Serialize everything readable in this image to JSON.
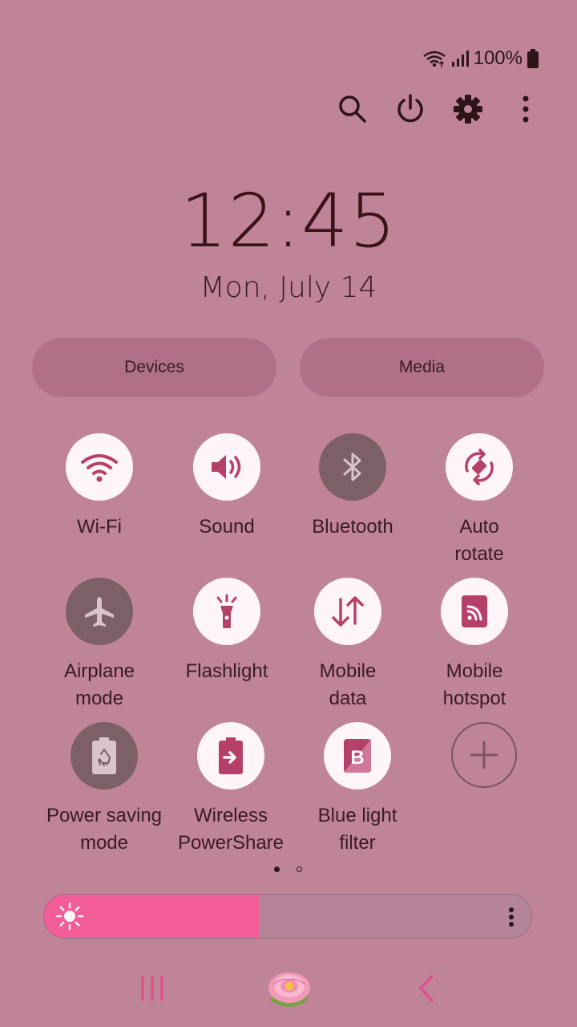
{
  "status_bar": {
    "battery_text": "100%",
    "icons": [
      "wifi-icon",
      "signal-icon",
      "battery-icon"
    ]
  },
  "actions": [
    "search-icon",
    "power-icon",
    "settings-icon",
    "more-icon"
  ],
  "clock": {
    "time": "12:45",
    "date": "Mon, July 14"
  },
  "pills": {
    "devices": "Devices",
    "media": "Media"
  },
  "tiles": [
    {
      "label": "Wi-Fi",
      "icon": "wifi-icon",
      "state": "on"
    },
    {
      "label": "Sound",
      "icon": "sound-icon",
      "state": "on"
    },
    {
      "label": "Bluetooth",
      "icon": "bluetooth-icon",
      "state": "off"
    },
    {
      "label": "Auto\nrotate",
      "icon": "auto-rotate-icon",
      "state": "on"
    },
    {
      "label": "Airplane\nmode",
      "icon": "airplane-icon",
      "state": "off"
    },
    {
      "label": "Flashlight",
      "icon": "flashlight-icon",
      "state": "on"
    },
    {
      "label": "Mobile\ndata",
      "icon": "mobile-data-icon",
      "state": "on"
    },
    {
      "label": "Mobile\nhotspot",
      "icon": "hotspot-icon",
      "state": "on"
    },
    {
      "label": "Power saving\nmode",
      "icon": "power-saving-icon",
      "state": "off"
    },
    {
      "label": "Wireless\nPowerShare",
      "icon": "powershare-icon",
      "state": "on"
    },
    {
      "label": "Blue light\nfilter",
      "icon": "blue-light-icon",
      "state": "on"
    },
    {
      "label": "",
      "icon": "add-icon",
      "state": "add"
    }
  ],
  "pager": {
    "current": 1,
    "total": 2
  },
  "brightness": {
    "level": 0.44
  },
  "colors": {
    "background": "#c08499",
    "accent": "#f25c97",
    "tile_on": "#fdf5f7",
    "tile_off": "#7d5f67",
    "icon_accent": "#b5416a"
  },
  "nav": [
    "recents-icon",
    "home-icon",
    "back-icon"
  ]
}
